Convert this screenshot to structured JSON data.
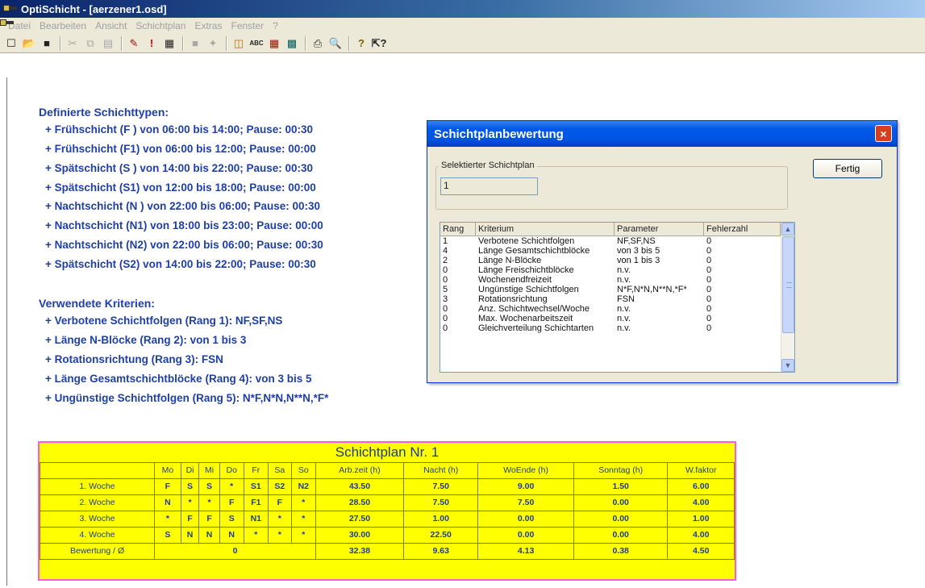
{
  "window": {
    "title": "OptiSchicht - [aerzener1.osd]"
  },
  "menu": [
    "Datei",
    "Bearbeiten",
    "Ansicht",
    "Schichtplan",
    "Extras",
    "Fenster",
    "?"
  ],
  "report": {
    "heading_types": "Definierte Schichttypen:",
    "shift_types": [
      "+ Frühschicht (F ) von 06:00 bis 14:00; Pause: 00:30",
      "+ Frühschicht (F1) von 06:00 bis 12:00; Pause: 00:00",
      "+ Spätschicht (S ) von 14:00 bis 22:00; Pause: 00:30",
      "+ Spätschicht (S1) von 12:00 bis 18:00; Pause: 00:00",
      "+ Nachtschicht (N ) von 22:00 bis 06:00; Pause: 00:30",
      "+ Nachtschicht (N1) von 18:00 bis 23:00; Pause: 00:00",
      "+ Nachtschicht (N2) von 22:00 bis 06:00; Pause: 00:30",
      "+ Spätschicht (S2) von 14:00 bis 22:00; Pause: 00:30"
    ],
    "heading_criteria": "Verwendete Kriterien:",
    "criteria": [
      "+ Verbotene Schichtfolgen (Rang 1): NF,SF,NS",
      "+ Länge N-Blöcke (Rang 2): von 1 bis 3",
      "+ Rotationsrichtung (Rang 3): FSN",
      "+ Länge Gesamtschichtblöcke (Rang 4): von 3 bis 5",
      "+ Ungünstige Schichtfolgen (Rang 5): N*F,N*N,N**N,*F*"
    ]
  },
  "dialog": {
    "title": "Schichtplanbewertung",
    "close_icon": "×",
    "group_label": "Selektierter Schichtplan",
    "selected_value": "1",
    "fertig_label": "Fertig",
    "columns": [
      "Rang",
      "Kriterium",
      "Parameter",
      "Fehlerzahl"
    ],
    "rows": [
      [
        "1",
        "Verbotene Schichtfolgen",
        "NF,SF,NS",
        "0"
      ],
      [
        "4",
        "Länge Gesamtschichtblöcke",
        "von 3 bis 5",
        "0"
      ],
      [
        "2",
        "Länge N-Blöcke",
        "von 1 bis 3",
        "0"
      ],
      [
        "0",
        "Länge Freischichtblöcke",
        "n.v.",
        "0"
      ],
      [
        "0",
        "Wochenendfreizeit",
        "n.v.",
        "0"
      ],
      [
        "5",
        "Ungünstige Schichtfolgen",
        "N*F,N*N,N**N,*F*",
        "0"
      ],
      [
        "3",
        "Rotationsrichtung",
        "FSN",
        "0"
      ],
      [
        "0",
        "Anz. Schichtwechsel/Woche",
        "n.v.",
        "0"
      ],
      [
        "0",
        "Max. Wochenarbeitszeit",
        "n.v.",
        "0"
      ],
      [
        "0",
        "Gleichverteilung Schichtarten",
        "n.v.",
        "0"
      ]
    ]
  },
  "plan": {
    "title": "Schichtplan Nr. 1",
    "headers": [
      "",
      "Mo",
      "Di",
      "Mi",
      "Do",
      "Fr",
      "Sa",
      "So",
      "Arb.zeit (h)",
      "Nacht (h)",
      "WoEnde (h)",
      "Sonntag (h)",
      "W.faktor"
    ],
    "rows": [
      [
        "1. Woche",
        "F",
        "S",
        "S",
        "*",
        "S1",
        "S2",
        "N2",
        "43.50",
        "7.50",
        "9.00",
        "1.50",
        "6.00"
      ],
      [
        "2. Woche",
        "N",
        "*",
        "*",
        "F",
        "F1",
        "F",
        "*",
        "28.50",
        "7.50",
        "7.50",
        "0.00",
        "4.00"
      ],
      [
        "3. Woche",
        "*",
        "F",
        "F",
        "S",
        "N1",
        "*",
        "*",
        "27.50",
        "1.00",
        "0.00",
        "0.00",
        "1.00"
      ],
      [
        "4. Woche",
        "S",
        "N",
        "N",
        "N",
        "*",
        "*",
        "*",
        "30.00",
        "22.50",
        "0.00",
        "0.00",
        "4.00"
      ]
    ],
    "footer": [
      "Bewertung / Ø",
      "0",
      "32.38",
      "9.63",
      "4.13",
      "0.38",
      "4.50"
    ]
  }
}
